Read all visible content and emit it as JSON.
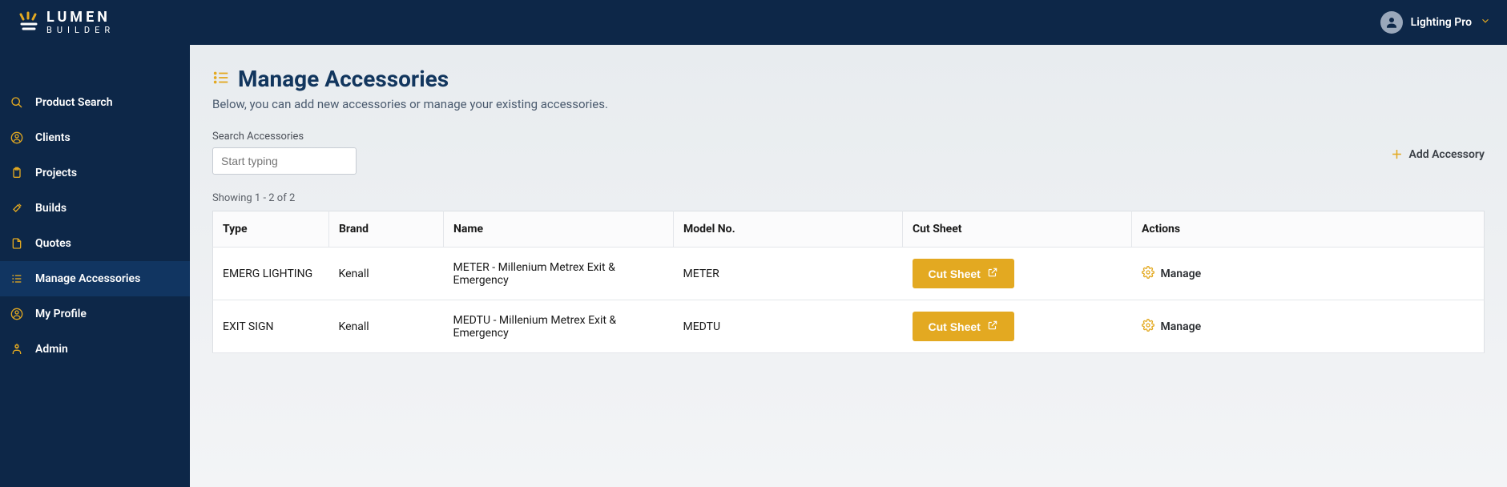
{
  "brand": {
    "name": "LUMEN",
    "sub": "BUILDER"
  },
  "user": {
    "name": "Lighting Pro"
  },
  "sidebar": {
    "items": [
      {
        "label": "Product Search",
        "icon": "search"
      },
      {
        "label": "Clients",
        "icon": "user-circle"
      },
      {
        "label": "Projects",
        "icon": "clipboard"
      },
      {
        "label": "Builds",
        "icon": "tools"
      },
      {
        "label": "Quotes",
        "icon": "file"
      },
      {
        "label": "Manage Accessories",
        "icon": "list"
      },
      {
        "label": "My Profile",
        "icon": "user-circle"
      },
      {
        "label": "Admin",
        "icon": "admin"
      }
    ]
  },
  "page": {
    "title": "Manage Accessories",
    "subtitle": "Below, you can add new accessories or manage your existing accessories.",
    "search_label": "Search Accessories",
    "search_placeholder": "Start typing",
    "add_label": "Add Accessory",
    "showing": "Showing 1 - 2 of 2"
  },
  "table": {
    "headers": [
      "Type",
      "Brand",
      "Name",
      "Model No.",
      "Cut Sheet",
      "Actions"
    ],
    "cut_label": "Cut Sheet",
    "manage_label": "Manage",
    "rows": [
      {
        "type": "EMERG LIGHTING",
        "brand": "Kenall",
        "name": "METER - Millenium Metrex Exit & Emergency",
        "model": "METER"
      },
      {
        "type": "EXIT SIGN",
        "brand": "Kenall",
        "name": "MEDTU - Millenium Metrex Exit & Emergency",
        "model": "MEDTU"
      }
    ]
  }
}
